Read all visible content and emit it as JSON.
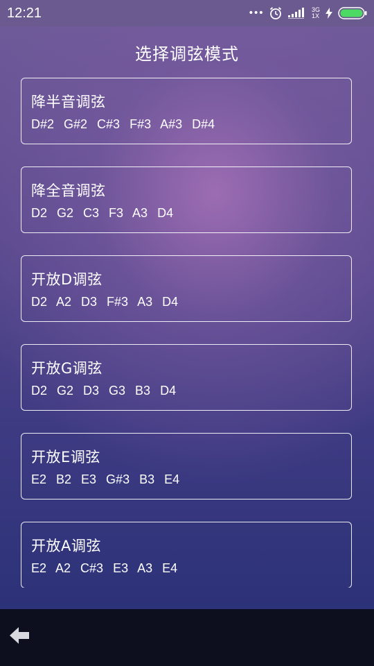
{
  "status_bar": {
    "time": "12:21",
    "more": "•••",
    "network_top": "3G",
    "network_bottom": "1X"
  },
  "page": {
    "title": "选择调弦模式"
  },
  "tunings": [
    {
      "name": "降半音调弦",
      "notes": "D#2  G#2  C#3  F#3  A#3  D#4"
    },
    {
      "name": "降全音调弦",
      "notes": "D2  G2  C3  F3  A3  D4"
    },
    {
      "name": "开放D调弦",
      "notes": "D2  A2  D3  F#3  A3  D4"
    },
    {
      "name": "开放G调弦",
      "notes": "D2  G2  D3  G3  B3  D4"
    },
    {
      "name": "开放E调弦",
      "notes": "E2  B2  E3  G#3  B3  E4"
    },
    {
      "name": "开放A调弦",
      "notes": "E2  A2  C#3  E3  A3  E4"
    }
  ],
  "icons": {
    "back": "back-arrow-icon",
    "alarm": "alarm-clock-icon",
    "signal": "signal-strength-icon",
    "charging": "charging-bolt-icon",
    "battery": "battery-icon"
  },
  "colors": {
    "accent_green": "#4cd964",
    "text": "#ffffff",
    "bottom_bar": "#0d0f1f"
  }
}
